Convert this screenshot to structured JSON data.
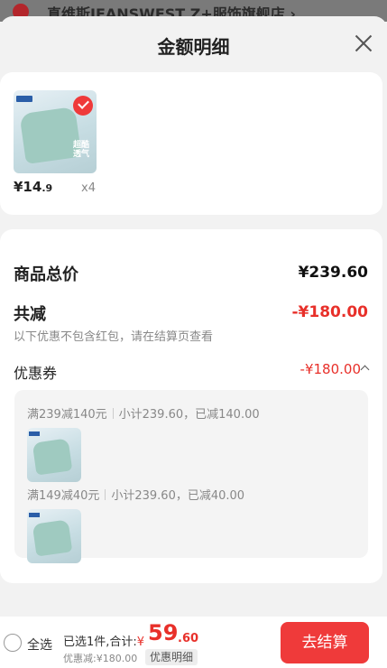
{
  "behind": {
    "store_name": "真维斯JEANSWEST Z+服饰旗舰店 ›"
  },
  "sheet": {
    "title": "金额明细"
  },
  "product": {
    "price_main": "¥14",
    "price_decimal": ".9",
    "quantity": "x4",
    "thumb_tag": "超酷\n透气"
  },
  "detail": {
    "total_label": "商品总价",
    "total_value": "¥239.60",
    "reduce_label": "共减",
    "reduce_value": "-¥180.00",
    "reduce_note": "以下优惠不包含红包，请在结算页查看",
    "coupon_label": "优惠券",
    "coupon_value": "-¥180.00",
    "coupons": [
      {
        "rule": "满239减140元",
        "summary": "小计239.60，已减140.00"
      },
      {
        "rule": "满149减40元",
        "summary": "小计239.60，已减40.00"
      }
    ]
  },
  "bottom": {
    "select_all": "全选",
    "selected_text": "已选1件,合计:",
    "currency": "¥",
    "total_int": "59",
    "total_dec": ".60",
    "discount_note": "优惠减:¥180.00",
    "detail_link": "优惠明细",
    "checkout": "去结算"
  },
  "colors": {
    "accent": "#ef3a3a",
    "price_red": "#e8302a"
  }
}
